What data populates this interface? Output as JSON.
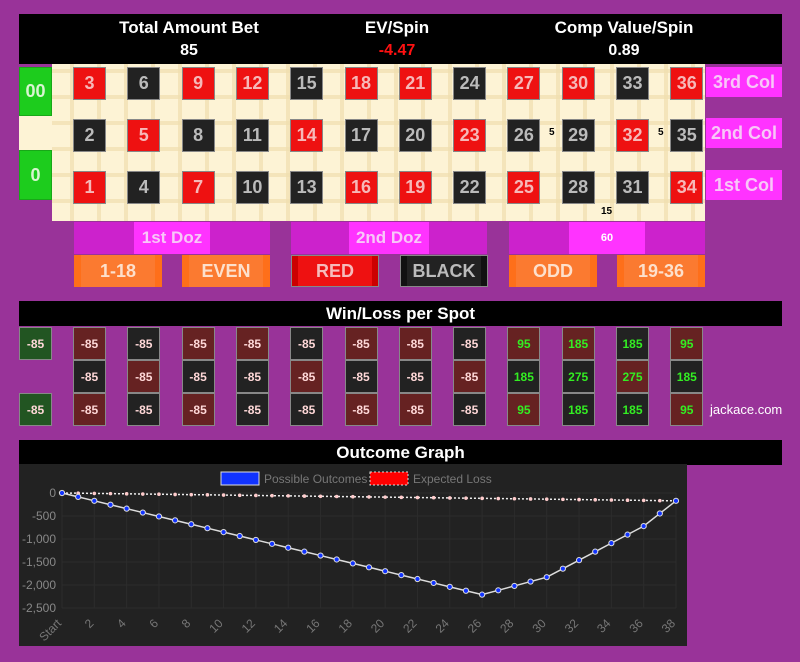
{
  "header": {
    "total_bet_label": "Total Amount Bet",
    "total_bet_value": "85",
    "ev_label": "EV/Spin",
    "ev_value": "-4.47",
    "comp_label": "Comp Value/Spin",
    "comp_value": "0.89",
    "ev_color": "#ff1111"
  },
  "table": {
    "zeros": [
      "00",
      "0"
    ],
    "rows": [
      [
        {
          "n": "3",
          "c": "red"
        },
        {
          "n": "6",
          "c": "black"
        },
        {
          "n": "9",
          "c": "red"
        },
        {
          "n": "12",
          "c": "red"
        },
        {
          "n": "15",
          "c": "black"
        },
        {
          "n": "18",
          "c": "red"
        },
        {
          "n": "21",
          "c": "red"
        },
        {
          "n": "24",
          "c": "black"
        },
        {
          "n": "27",
          "c": "red"
        },
        {
          "n": "30",
          "c": "red"
        },
        {
          "n": "33",
          "c": "black"
        },
        {
          "n": "36",
          "c": "red"
        }
      ],
      [
        {
          "n": "2",
          "c": "black"
        },
        {
          "n": "5",
          "c": "red"
        },
        {
          "n": "8",
          "c": "black"
        },
        {
          "n": "11",
          "c": "black"
        },
        {
          "n": "14",
          "c": "red"
        },
        {
          "n": "17",
          "c": "black"
        },
        {
          "n": "20",
          "c": "black"
        },
        {
          "n": "23",
          "c": "red"
        },
        {
          "n": "26",
          "c": "black"
        },
        {
          "n": "29",
          "c": "black"
        },
        {
          "n": "32",
          "c": "red"
        },
        {
          "n": "35",
          "c": "black"
        }
      ],
      [
        {
          "n": "1",
          "c": "red"
        },
        {
          "n": "4",
          "c": "black"
        },
        {
          "n": "7",
          "c": "red"
        },
        {
          "n": "10",
          "c": "black"
        },
        {
          "n": "13",
          "c": "black"
        },
        {
          "n": "16",
          "c": "red"
        },
        {
          "n": "19",
          "c": "red"
        },
        {
          "n": "22",
          "c": "black"
        },
        {
          "n": "25",
          "c": "red"
        },
        {
          "n": "28",
          "c": "black"
        },
        {
          "n": "31",
          "c": "black"
        },
        {
          "n": "34",
          "c": "red"
        }
      ]
    ],
    "column_bets": [
      "3rd Col",
      "2nd Col",
      "1st Col"
    ],
    "dozens": [
      "1st Doz",
      "2nd Doz",
      "60"
    ],
    "even_money": [
      "1-18",
      "EVEN",
      "RED",
      "BLACK",
      "ODD",
      "19-36"
    ],
    "chips": [
      {
        "label": "5",
        "position": "split 26-29"
      },
      {
        "label": "5",
        "position": "split 32-35"
      },
      {
        "label": "15",
        "position": "street 28-30 corner"
      },
      {
        "label": "60",
        "position": "3rd Doz"
      }
    ]
  },
  "winloss": {
    "title": "Win/Loss per Spot",
    "zeros": [
      "-85",
      "-85"
    ],
    "rows": [
      [
        {
          "v": "-85",
          "c": "r"
        },
        {
          "v": "-85",
          "c": "b"
        },
        {
          "v": "-85",
          "c": "r"
        },
        {
          "v": "-85",
          "c": "r"
        },
        {
          "v": "-85",
          "c": "b"
        },
        {
          "v": "-85",
          "c": "r"
        },
        {
          "v": "-85",
          "c": "r"
        },
        {
          "v": "-85",
          "c": "b"
        },
        {
          "v": "95",
          "c": "r"
        },
        {
          "v": "185",
          "c": "r"
        },
        {
          "v": "185",
          "c": "b"
        },
        {
          "v": "95",
          "c": "r"
        }
      ],
      [
        {
          "v": "-85",
          "c": "b"
        },
        {
          "v": "-85",
          "c": "r"
        },
        {
          "v": "-85",
          "c": "b"
        },
        {
          "v": "-85",
          "c": "b"
        },
        {
          "v": "-85",
          "c": "r"
        },
        {
          "v": "-85",
          "c": "b"
        },
        {
          "v": "-85",
          "c": "b"
        },
        {
          "v": "-85",
          "c": "r"
        },
        {
          "v": "185",
          "c": "b"
        },
        {
          "v": "275",
          "c": "b"
        },
        {
          "v": "275",
          "c": "r"
        },
        {
          "v": "185",
          "c": "b"
        }
      ],
      [
        {
          "v": "-85",
          "c": "r"
        },
        {
          "v": "-85",
          "c": "b"
        },
        {
          "v": "-85",
          "c": "r"
        },
        {
          "v": "-85",
          "c": "b"
        },
        {
          "v": "-85",
          "c": "b"
        },
        {
          "v": "-85",
          "c": "r"
        },
        {
          "v": "-85",
          "c": "r"
        },
        {
          "v": "-85",
          "c": "b"
        },
        {
          "v": "95",
          "c": "r"
        },
        {
          "v": "185",
          "c": "b"
        },
        {
          "v": "185",
          "c": "b"
        },
        {
          "v": "95",
          "c": "r"
        }
      ]
    ],
    "credit": "jackace.com"
  },
  "graph": {
    "title": "Outcome Graph"
  },
  "chart_data": {
    "type": "line",
    "title": "Outcome Graph",
    "xlabel": "",
    "ylabel": "",
    "x": [
      "Start",
      "1",
      "2",
      "3",
      "4",
      "5",
      "6",
      "7",
      "8",
      "9",
      "10",
      "11",
      "12",
      "13",
      "14",
      "15",
      "16",
      "17",
      "18",
      "19",
      "20",
      "21",
      "22",
      "23",
      "24",
      "25",
      "26",
      "27",
      "28",
      "29",
      "30",
      "31",
      "32",
      "33",
      "34",
      "35",
      "36",
      "37",
      "38"
    ],
    "x_tick_labels": [
      "Start",
      "2",
      "4",
      "6",
      "8",
      "10",
      "12",
      "14",
      "16",
      "18",
      "20",
      "22",
      "24",
      "26",
      "28",
      "30",
      "32",
      "34",
      "36",
      "38"
    ],
    "y_tick_labels": [
      "0",
      "-500",
      "-1,000",
      "-1,500",
      "-2,000",
      "-2,500"
    ],
    "ylim": [
      -2500,
      0
    ],
    "grid": true,
    "legend": "top-center",
    "series": [
      {
        "name": "Possible Outcomes",
        "color": "#1133ff",
        "values": [
          0,
          -85,
          -170,
          -255,
          -340,
          -425,
          -510,
          -595,
          -680,
          -765,
          -850,
          -935,
          -1020,
          -1105,
          -1190,
          -1275,
          -1360,
          -1445,
          -1530,
          -1615,
          -1700,
          -1785,
          -1870,
          -1955,
          -2040,
          -2125,
          -2210,
          -2115,
          -2020,
          -1925,
          -1830,
          -1645,
          -1460,
          -1275,
          -1090,
          -905,
          -720,
          -445,
          -170
        ]
      },
      {
        "name": "Expected Loss",
        "color": "#ff0000",
        "values": [
          0,
          -4.47,
          -8.95,
          -13.42,
          -17.89,
          -22.37,
          -26.84,
          -31.32,
          -35.79,
          -40.26,
          -44.74,
          -49.21,
          -53.68,
          -58.16,
          -62.63,
          -67.11,
          -71.58,
          -76.05,
          -80.53,
          -85,
          -89.47,
          -93.95,
          -98.42,
          -102.89,
          -107.37,
          -111.84,
          -116.32,
          -120.79,
          -125.26,
          -129.74,
          -134.21,
          -138.68,
          -143.16,
          -147.63,
          -152.11,
          -156.58,
          -161.05,
          -165.53,
          -170
        ]
      }
    ]
  }
}
